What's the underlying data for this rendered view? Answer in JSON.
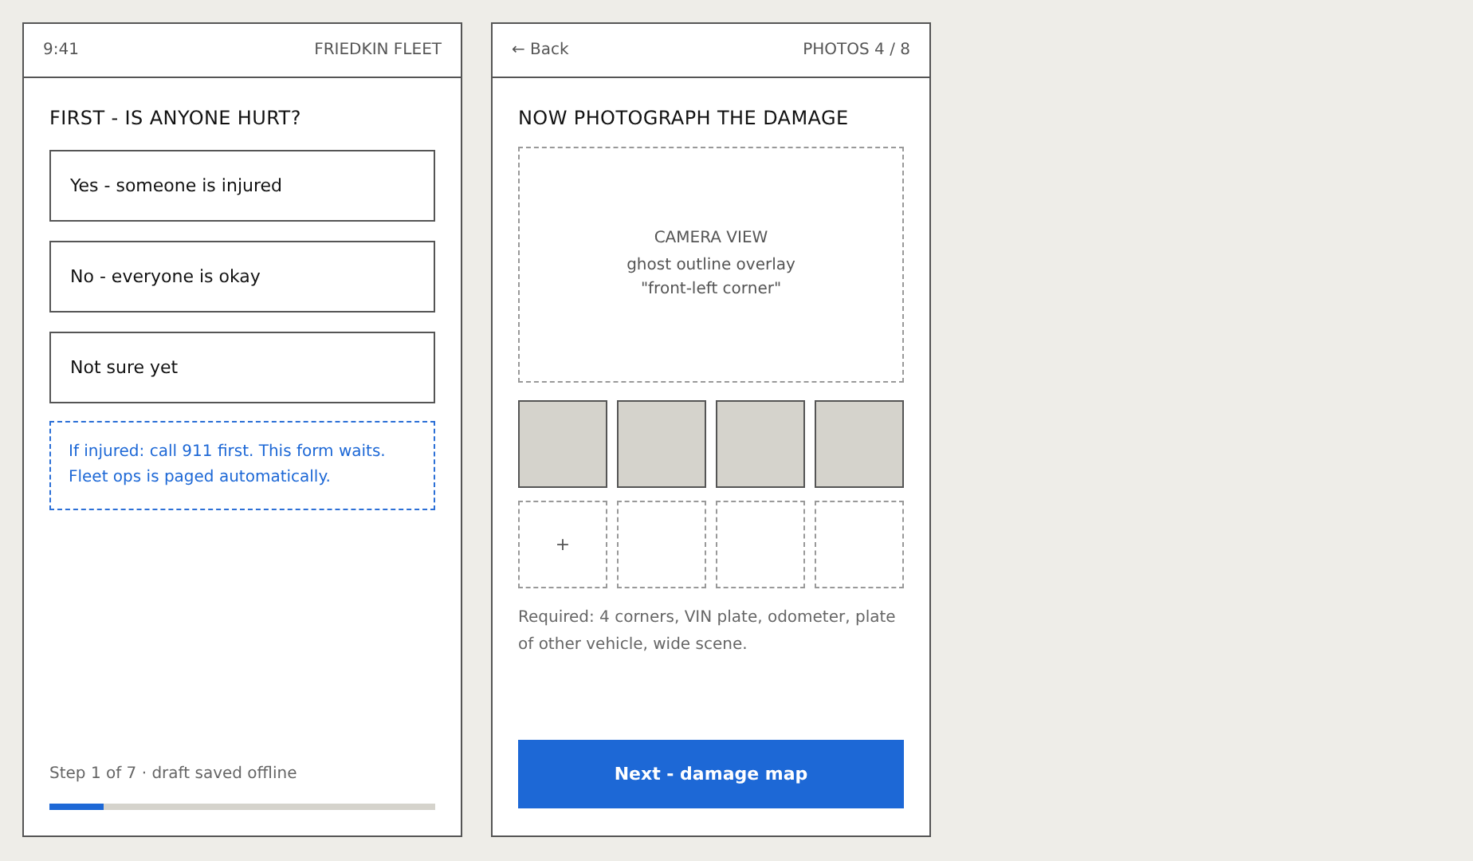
{
  "screens": [
    {
      "status_bar": {
        "time": "9:41",
        "brand": "FRIEDKIN FLEET"
      },
      "title": "FIRST - IS ANYONE HURT?",
      "options": [
        {
          "label": "Yes - someone is injured"
        },
        {
          "label": "No - everyone is okay"
        },
        {
          "label": "Not sure yet"
        }
      ],
      "note": "If injured: call 911 first. This form waits. Fleet ops is paged automatically.",
      "footer": {
        "text": "Step 1 of 7 · draft saved offline",
        "level": 0.14
      }
    },
    {
      "nav": {
        "back": "← Back",
        "counter": "PHOTOS 4 / 8"
      },
      "title": "NOW PHOTOGRAPH THE DAMAGE",
      "camera": {
        "heading": "CAMERA VIEW",
        "lines": [
          "ghost outline overlay",
          "\"front-left corner\""
        ]
      },
      "slots": [
        {
          "filled": true
        },
        {
          "filled": true
        },
        {
          "filled": true
        },
        {
          "filled": true
        },
        {
          "filled": false,
          "label": "+"
        },
        {
          "filled": false
        },
        {
          "filled": false
        },
        {
          "filled": false
        }
      ],
      "hint": "Required: 4 corners, VIN plate, odometer, plate of other vehicle, wide scene.",
      "button": "Next - damage map"
    }
  ]
}
